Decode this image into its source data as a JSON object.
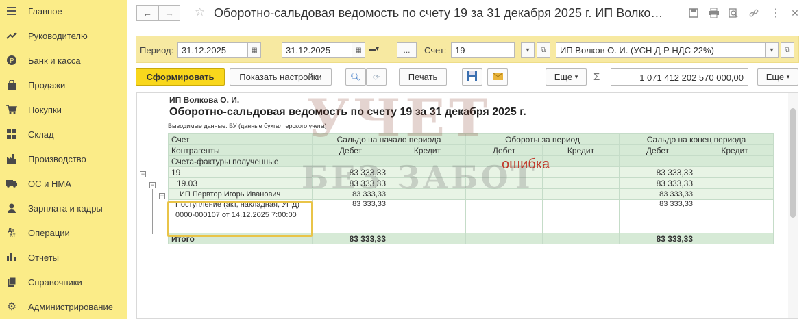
{
  "sidebar": {
    "items": [
      {
        "label": "Главное",
        "icon": "menu-icon"
      },
      {
        "label": "Руководителю",
        "icon": "trend-icon"
      },
      {
        "label": "Банк и касса",
        "icon": "ruble-icon"
      },
      {
        "label": "Продажи",
        "icon": "bag-icon"
      },
      {
        "label": "Покупки",
        "icon": "cart-icon"
      },
      {
        "label": "Склад",
        "icon": "warehouse-icon"
      },
      {
        "label": "Производство",
        "icon": "factory-icon"
      },
      {
        "label": "ОС и НМА",
        "icon": "truck-icon"
      },
      {
        "label": "Зарплата и кадры",
        "icon": "person-icon"
      },
      {
        "label": "Операции",
        "icon": "operations-icon"
      },
      {
        "label": "Отчеты",
        "icon": "bar-chart-icon"
      },
      {
        "label": "Справочники",
        "icon": "books-icon"
      },
      {
        "label": "Администрирование",
        "icon": "gear-icon"
      }
    ]
  },
  "header": {
    "title": "Оборотно-сальдовая ведомость по счету 19 за 31 декабря 2025 г. ИП Волко…"
  },
  "filter": {
    "period_label": "Период:",
    "date_from": "31.12.2025",
    "dash": "–",
    "date_to": "31.12.2025",
    "ellipsis": "...",
    "account_label": "Счет:",
    "account": "19",
    "organization": "ИП Волков О. И. (УСН Д-Р НДС 22%)"
  },
  "actions": {
    "generate": "Сформировать",
    "show_settings": "Показать настройки",
    "print": "Печать",
    "more": "Еще",
    "more_right": "Еще",
    "sum": "1 071 412 202 570 000,00"
  },
  "report": {
    "org": "ИП Волкова О. И.",
    "title": "Оборотно-сальдовая ведомость по счету 19 за 31 декабря 2025 г.",
    "subtitle": "Выводимые данные: БУ (данные бухгалтерского учета)",
    "header": {
      "col_account": "Счет",
      "col_contragent": "Контрагенты",
      "col_invoices": "Счета-фактуры полученные",
      "opening": "Сальдо на начало периода",
      "turnover": "Обороты за период",
      "closing": "Сальдо на конец периода",
      "debit": "Дебет",
      "credit": "Кредит"
    },
    "rows": [
      {
        "name": "19",
        "open_debit": "83 333,33",
        "close_debit": "83 333,33"
      },
      {
        "name": "19.03",
        "open_debit": "83 333,33",
        "close_debit": "83 333,33"
      },
      {
        "name": "ИП Первтор Игорь Иванович",
        "open_debit": "83 333,33",
        "close_debit": "83 333,33"
      },
      {
        "name": "Поступление (акт, накладная, УПД) 0000-000107 от 14.12.2025 7:00:00",
        "open_debit": "83 333,33",
        "close_debit": "83 333,33"
      }
    ],
    "total": {
      "name": "Итого",
      "open_debit": "83 333,33",
      "close_debit": "83 333,33"
    }
  },
  "annotation": "ошибка",
  "watermark": {
    "line1": "УЧЕТ",
    "line2": "БЕЗ ЗАБОТ"
  },
  "colors": {
    "sidebar_bg": "#fbec88",
    "primary_button": "#f9d71c",
    "filter_bg": "#f7e9a1",
    "table_header": "#d6ead6",
    "error_text": "#c0392b",
    "highlight_border": "#e9c448"
  }
}
